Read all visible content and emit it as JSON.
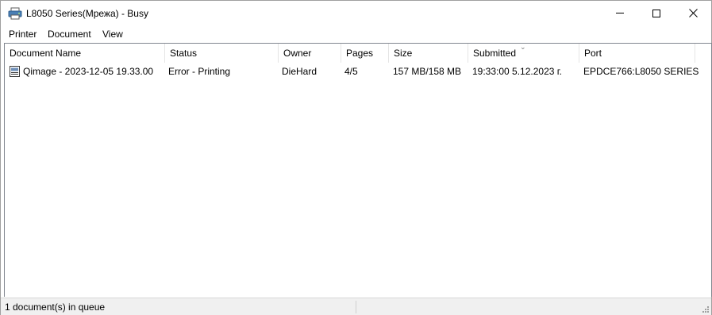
{
  "window": {
    "title": "L8050 Series(Мрежа) - Busy",
    "app_icon": "printer-icon"
  },
  "menu": {
    "printer": "Printer",
    "document": "Document",
    "view": "View"
  },
  "columns": {
    "document_name": "Document Name",
    "status": "Status",
    "owner": "Owner",
    "pages": "Pages",
    "size": "Size",
    "submitted": "Submitted",
    "port": "Port",
    "sorted_by": "Submitted",
    "sort_icon": "sort-chevron-down-icon"
  },
  "jobs": [
    {
      "icon": "document-icon",
      "document_name": "Qimage - 2023-12-05 19.33.00",
      "status": "Error - Printing",
      "owner": "DieHard",
      "pages": "4/5",
      "size": "157 MB/158 MB",
      "submitted": "19:33:00  5.12.2023 г.",
      "port": "EPDCE766:L8050 SERIES"
    }
  ],
  "statusbar": {
    "queue_text": "1 document(s) in queue"
  }
}
